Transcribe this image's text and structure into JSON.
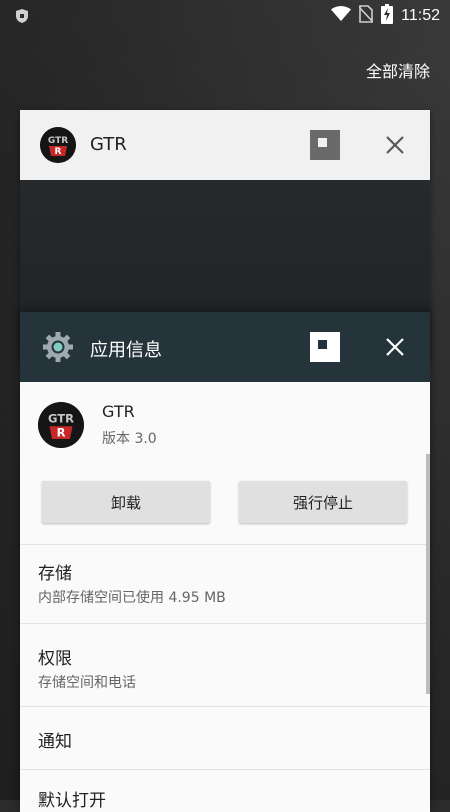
{
  "status_bar": {
    "time": "11:52",
    "icons": [
      "shield-icon",
      "wifi-icon",
      "no-sim-icon",
      "battery-charging-icon"
    ]
  },
  "clear_all_label": "全部清除",
  "recent_cards": [
    {
      "title": "GTR",
      "icon": "gtr-app-icon"
    },
    {
      "title": "应用信息",
      "icon": "settings-gear-icon"
    }
  ],
  "app_info": {
    "app_name": "GTR",
    "version": "版本 3.0",
    "uninstall_label": "卸载",
    "force_stop_label": "强行停止",
    "storage": {
      "title": "存储",
      "subtitle": "内部存储空间已使用 4.95 MB"
    },
    "permissions": {
      "title": "权限",
      "subtitle": "存储空间和电话"
    },
    "notifications": {
      "title": "通知"
    },
    "open_by_default": {
      "title": "默认打开"
    }
  },
  "colors": {
    "card_header_dark": "#25343b",
    "card_header_light": "#f1f1f1",
    "accent_teal": "#80cbc4"
  }
}
